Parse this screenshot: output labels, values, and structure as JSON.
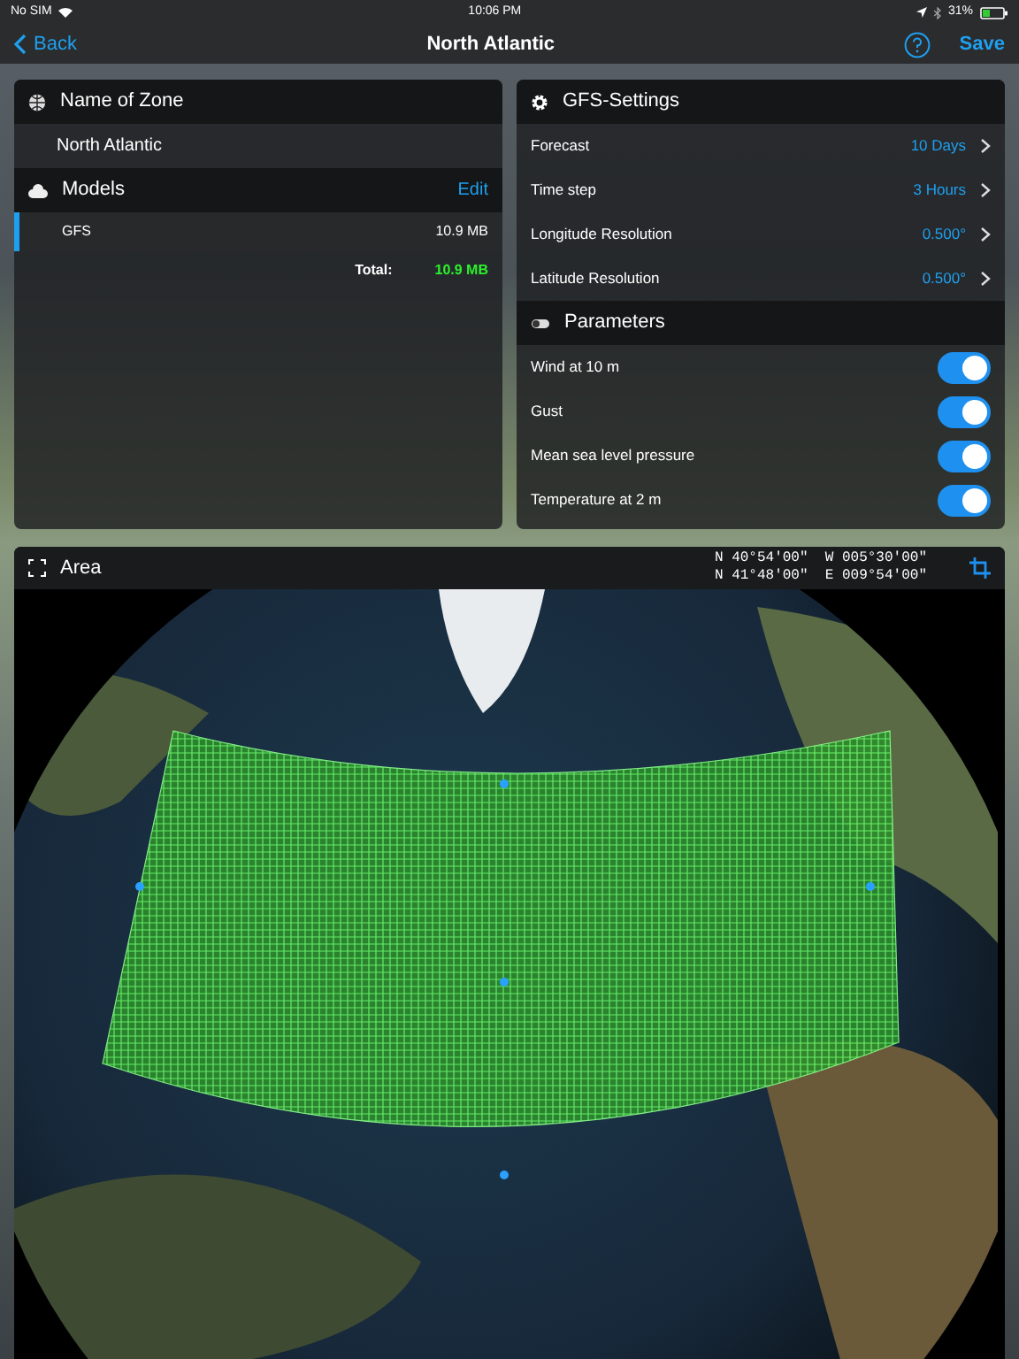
{
  "status_bar": {
    "carrier": "No SIM",
    "time": "10:06 PM",
    "battery": "31%"
  },
  "nav": {
    "back": "Back",
    "title": "North Atlantic",
    "save": "Save"
  },
  "zone": {
    "header": "Name of Zone",
    "value": "North Atlantic"
  },
  "models": {
    "header": "Models",
    "action": "Edit",
    "items": [
      {
        "name": "GFS",
        "size": "10.9 MB",
        "selected": true
      }
    ],
    "total_label": "Total:",
    "total": "10.9 MB"
  },
  "gfs_settings": {
    "header": "GFS-Settings",
    "rows": [
      {
        "label": "Forecast",
        "value": "10 Days"
      },
      {
        "label": "Time step",
        "value": "3 Hours"
      },
      {
        "label": "Longitude Resolution",
        "value": "0.500°"
      },
      {
        "label": "Latitude Resolution",
        "value": "0.500°"
      }
    ]
  },
  "parameters": {
    "header": "Parameters",
    "items": [
      {
        "label": "Wind at 10 m",
        "on": true
      },
      {
        "label": "Gust",
        "on": true
      },
      {
        "label": "Mean sea level pressure",
        "on": true
      },
      {
        "label": "Temperature at 2 m",
        "on": true
      }
    ]
  },
  "area": {
    "title": "Area",
    "coords": [
      "N 40°54'00\"  W 005°30'00\"",
      "N 41°48'00\"  E 009°54'00\""
    ]
  }
}
